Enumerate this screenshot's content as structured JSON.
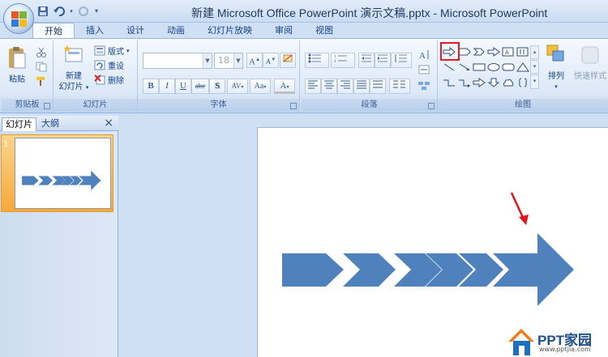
{
  "window": {
    "title": "新建 Microsoft Office PowerPoint 演示文稿.pptx - Microsoft PowerPoint"
  },
  "tabs": [
    "开始",
    "插入",
    "设计",
    "动画",
    "幻灯片放映",
    "审阅",
    "视图"
  ],
  "ribbon": {
    "clipboard": {
      "label": "剪贴板",
      "paste": "粘贴"
    },
    "slides": {
      "label": "幻灯片",
      "new_slide_line1": "新建",
      "new_slide_line2": "幻灯片",
      "layout": "版式",
      "reset": "重设",
      "delete": "删除"
    },
    "font": {
      "label": "字体",
      "font_size": "18",
      "bold": "B",
      "italic": "I",
      "underline": "U",
      "strike": "abe",
      "spacing": "AV",
      "case": "Aa",
      "color": "A",
      "grow": "A",
      "shrink": "A"
    },
    "paragraph": {
      "label": "段落"
    },
    "drawing": {
      "label": "绘图",
      "arrange": "排列",
      "quick_styles": "快速样式"
    }
  },
  "left_pane": {
    "tab_slides": "幻灯片",
    "tab_outline": "大纲",
    "close": "×",
    "slide_number": "1"
  },
  "watermark": {
    "text": "PPT家园",
    "url": "www.pptjia.com"
  },
  "colors": {
    "shape_fill": "#4f81bd",
    "highlight": "#e51b24",
    "annotation_arrow": "#e0161f"
  }
}
